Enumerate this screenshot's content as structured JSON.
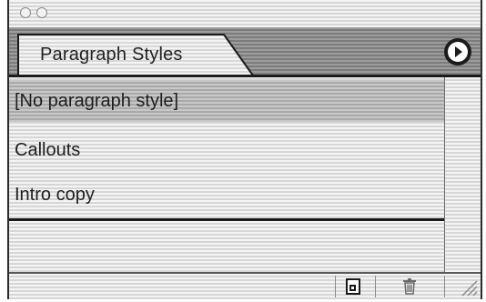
{
  "panel": {
    "tab_label": "Paragraph Styles",
    "styles": [
      {
        "label": "[No paragraph style]",
        "selected": true
      },
      {
        "label": "Callouts",
        "selected": false
      },
      {
        "label": "Intro copy",
        "selected": false
      }
    ]
  },
  "icons": {
    "window_buttons": [
      "close-button-icon",
      "minimize-button-icon"
    ],
    "panel_menu": "arrow-right-circle-icon",
    "new_style": "new-page-icon",
    "delete_style": "trash-icon",
    "resize": "resize-grip-icon"
  }
}
